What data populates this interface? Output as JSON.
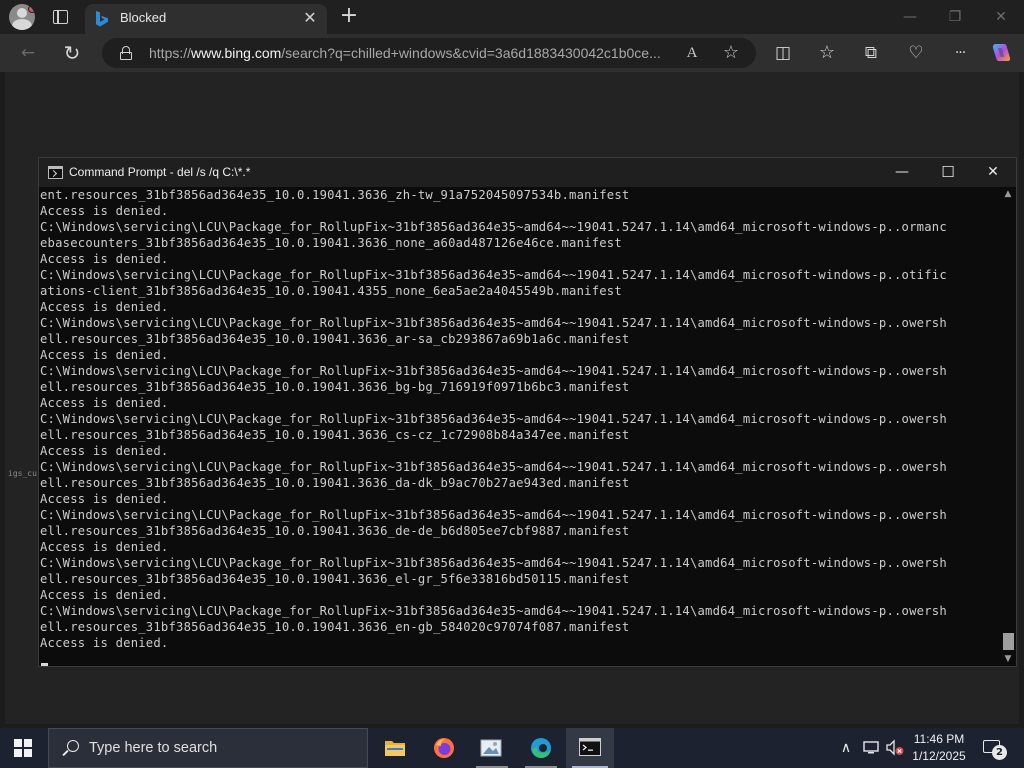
{
  "browser": {
    "tab": {
      "title": "Blocked",
      "close": "✕"
    },
    "new_tab": "+",
    "window_controls": {
      "minimize": "—",
      "restore": "❐",
      "close": "✕"
    },
    "address": {
      "prefix": "https://",
      "host": "www.bing.com",
      "path": "/search?q=chilled+windows&cvid=3a6d1883430042c1b0ce..."
    },
    "toolbar_glyphs": {
      "back": "←",
      "refresh": "↻",
      "read_aloud": "A",
      "favorite": "☆",
      "split": "◫",
      "favorites": "☆",
      "collections": "⧉",
      "performance": "♡",
      "more": "···"
    },
    "side_fragment": "igs_cu"
  },
  "cmd": {
    "title": "Command Prompt - del  /s /q C:\\*.*",
    "controls": {
      "minimize": "—",
      "maximize": "☐",
      "close": "✕"
    },
    "lines": [
      "ent.resources_31bf3856ad364e35_10.0.19041.3636_zh-tw_91a752045097534b.manifest",
      "Access is denied.",
      "C:\\Windows\\servicing\\LCU\\Package_for_RollupFix~31bf3856ad364e35~amd64~~19041.5247.1.14\\amd64_microsoft-windows-p..ormanc",
      "ebasecounters_31bf3856ad364e35_10.0.19041.3636_none_a60ad487126e46ce.manifest",
      "Access is denied.",
      "C:\\Windows\\servicing\\LCU\\Package_for_RollupFix~31bf3856ad364e35~amd64~~19041.5247.1.14\\amd64_microsoft-windows-p..otific",
      "ations-client_31bf3856ad364e35_10.0.19041.4355_none_6ea5ae2a4045549b.manifest",
      "Access is denied.",
      "C:\\Windows\\servicing\\LCU\\Package_for_RollupFix~31bf3856ad364e35~amd64~~19041.5247.1.14\\amd64_microsoft-windows-p..owersh",
      "ell.resources_31bf3856ad364e35_10.0.19041.3636_ar-sa_cb293867a69b1a6c.manifest",
      "Access is denied.",
      "C:\\Windows\\servicing\\LCU\\Package_for_RollupFix~31bf3856ad364e35~amd64~~19041.5247.1.14\\amd64_microsoft-windows-p..owersh",
      "ell.resources_31bf3856ad364e35_10.0.19041.3636_bg-bg_716919f0971b6bc3.manifest",
      "Access is denied.",
      "C:\\Windows\\servicing\\LCU\\Package_for_RollupFix~31bf3856ad364e35~amd64~~19041.5247.1.14\\amd64_microsoft-windows-p..owersh",
      "ell.resources_31bf3856ad364e35_10.0.19041.3636_cs-cz_1c72908b84a347ee.manifest",
      "Access is denied.",
      "C:\\Windows\\servicing\\LCU\\Package_for_RollupFix~31bf3856ad364e35~amd64~~19041.5247.1.14\\amd64_microsoft-windows-p..owersh",
      "ell.resources_31bf3856ad364e35_10.0.19041.3636_da-dk_b9ac70b27ae943ed.manifest",
      "Access is denied.",
      "C:\\Windows\\servicing\\LCU\\Package_for_RollupFix~31bf3856ad364e35~amd64~~19041.5247.1.14\\amd64_microsoft-windows-p..owersh",
      "ell.resources_31bf3856ad364e35_10.0.19041.3636_de-de_b6d805ee7cbf9887.manifest",
      "Access is denied.",
      "C:\\Windows\\servicing\\LCU\\Package_for_RollupFix~31bf3856ad364e35~amd64~~19041.5247.1.14\\amd64_microsoft-windows-p..owersh",
      "ell.resources_31bf3856ad364e35_10.0.19041.3636_el-gr_5f6e33816bd50115.manifest",
      "Access is denied.",
      "C:\\Windows\\servicing\\LCU\\Package_for_RollupFix~31bf3856ad364e35~amd64~~19041.5247.1.14\\amd64_microsoft-windows-p..owersh",
      "ell.resources_31bf3856ad364e35_10.0.19041.3636_en-gb_584020c97074f087.manifest",
      "Access is denied."
    ],
    "scroll_up": "▲",
    "scroll_down": "▼"
  },
  "taskbar": {
    "search_placeholder": "Type here to search",
    "apps": [
      "file-explorer",
      "firefox",
      "photos",
      "edge",
      "command-prompt"
    ],
    "tray": {
      "chevron": "∧",
      "network": "▭",
      "volume": "◁"
    },
    "time": "11:46 PM",
    "date": "1/12/2025",
    "notification_count": "2"
  },
  "colors": {
    "accent_bing": "#2b8cd6",
    "cmd_text": "#cccccc",
    "taskbar": "#1c2230"
  }
}
